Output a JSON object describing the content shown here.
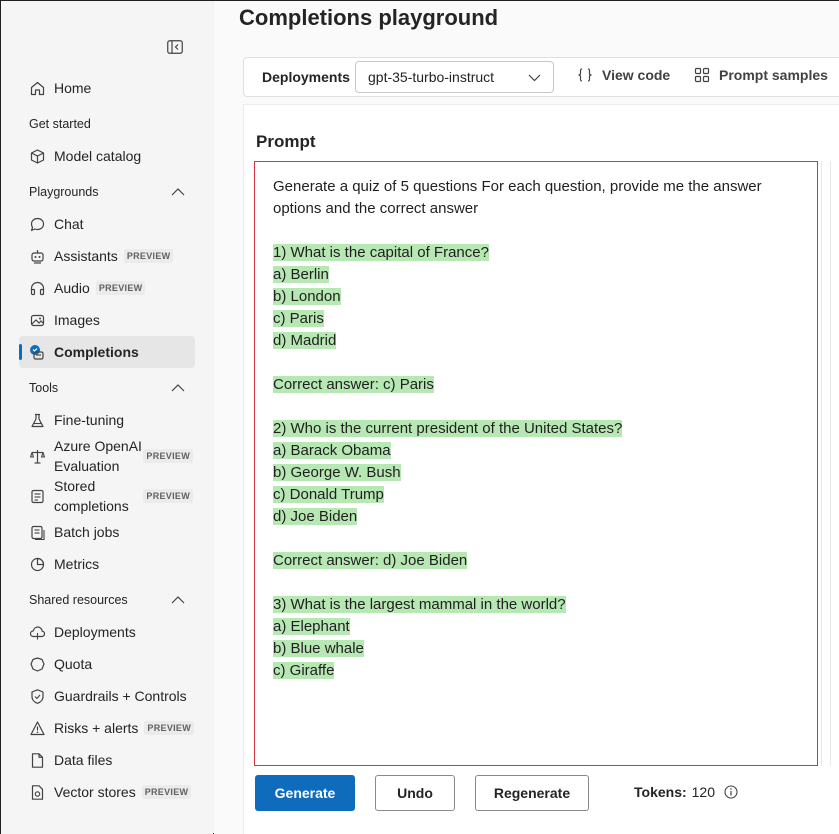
{
  "sidebar": {
    "items": {
      "home": "Home",
      "model_catalog": "Model catalog",
      "chat": "Chat",
      "assistants": "Assistants",
      "audio": "Audio",
      "images": "Images",
      "completions": "Completions",
      "fine_tuning": "Fine-tuning",
      "azure_openai_evaluation": "Azure OpenAI Evaluation",
      "stored_completions": "Stored completions",
      "batch_jobs": "Batch jobs",
      "metrics": "Metrics",
      "deployments": "Deployments",
      "quota": "Quota",
      "guardrails": "Guardrails + Controls",
      "risks_alerts": "Risks + alerts",
      "data_files": "Data files",
      "vector_stores": "Vector stores"
    },
    "sections": {
      "get_started": "Get started",
      "playgrounds": "Playgrounds",
      "tools": "Tools",
      "shared_resources": "Shared resources"
    },
    "preview_badge": "PREVIEW",
    "active_item": "Completions",
    "accent_color": "#0f6cbd"
  },
  "main": {
    "title": "Completions playground",
    "toolbar": {
      "deployments_label": "Deployments",
      "deployment_selected": "gpt-35-turbo-instruct",
      "view_code": "View code",
      "prompt_samples": "Prompt samples"
    },
    "prompt_heading": "Prompt",
    "prompt_lines": [
      {
        "text": "Generate a quiz of 5 questions For each question, provide me the answer options and the correct answer",
        "highlight": false
      },
      {
        "text": "",
        "highlight": false
      },
      {
        "text": "1) What is the capital of France?",
        "highlight": true
      },
      {
        "text": "a) Berlin",
        "highlight": true
      },
      {
        "text": "b) London",
        "highlight": true
      },
      {
        "text": "c) Paris",
        "highlight": true
      },
      {
        "text": "d) Madrid",
        "highlight": true
      },
      {
        "text": "",
        "highlight": false
      },
      {
        "text": "Correct answer: c) Paris",
        "highlight": true
      },
      {
        "text": "",
        "highlight": false
      },
      {
        "text": "2) Who is the current president of the United States?",
        "highlight": true
      },
      {
        "text": "a) Barack Obama",
        "highlight": true
      },
      {
        "text": "b) George W. Bush",
        "highlight": true
      },
      {
        "text": "c) Donald Trump",
        "highlight": true
      },
      {
        "text": "d) Joe Biden",
        "highlight": true
      },
      {
        "text": "",
        "highlight": false
      },
      {
        "text": "Correct answer: d) Joe Biden",
        "highlight": true
      },
      {
        "text": "",
        "highlight": false
      },
      {
        "text": "3) What is the largest mammal in the world?",
        "highlight": true
      },
      {
        "text": "a) Elephant",
        "highlight": true
      },
      {
        "text": "b) Blue whale",
        "highlight": true
      },
      {
        "text": "c) Giraffe",
        "highlight": true
      }
    ],
    "highlight_color": "#b7e8b4",
    "buttons": {
      "generate": "Generate",
      "undo": "Undo",
      "regenerate": "Regenerate"
    },
    "tokens_label": "Tokens:",
    "tokens_value": "120"
  }
}
